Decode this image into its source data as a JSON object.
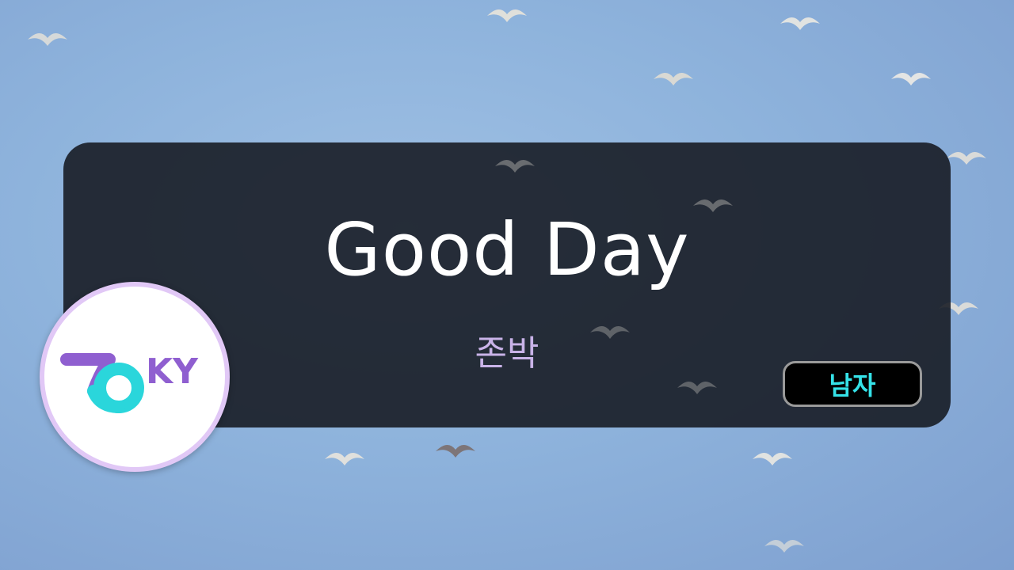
{
  "song": {
    "title": "Good Day",
    "artist": "존박",
    "tag": "남자"
  },
  "logo": {
    "text": "KY"
  },
  "colors": {
    "title": "#ffffff",
    "artist": "#c9b3e8",
    "tag_text": "#35e2e8",
    "logo_purple": "#8f5fd0",
    "logo_cyan": "#2ad6db"
  }
}
